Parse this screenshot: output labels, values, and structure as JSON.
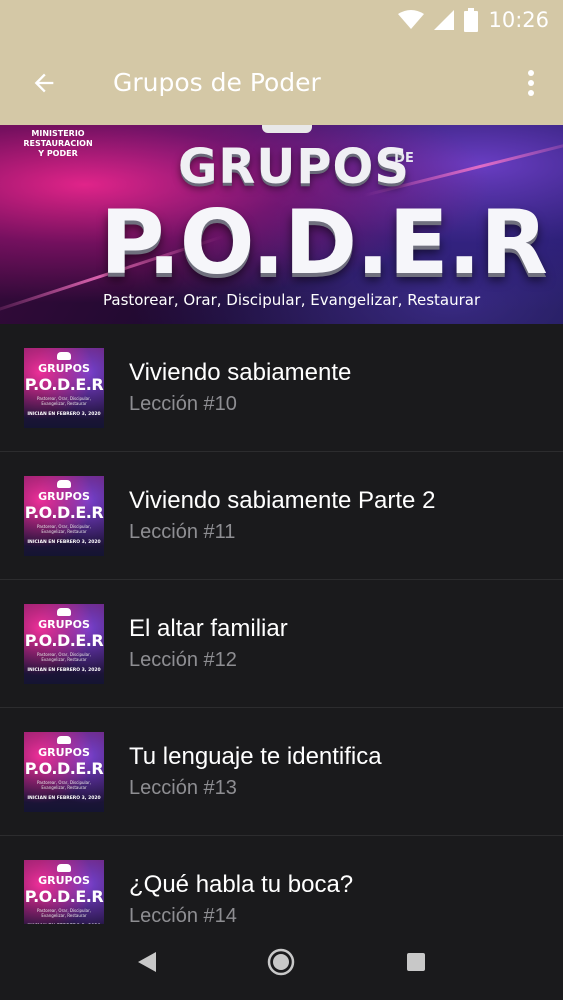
{
  "status_bar": {
    "time": "10:26",
    "icons": [
      "wifi-icon",
      "signal-icon",
      "battery-icon"
    ]
  },
  "app_bar": {
    "title": "Grupos de Poder",
    "back_icon": "arrow-back-icon",
    "menu_icon": "more-vert-icon",
    "background_color": "#d4c8a6"
  },
  "banner": {
    "ministry_line1": "MINISTERIO",
    "ministry_line2": "RESTAURACION",
    "ministry_line3": "Y PODER",
    "heading_top": "GRUPOS",
    "heading_de": "DE",
    "heading_main": "P.O.D.E.R",
    "tagline": "Pastorear, Orar, Discipular, Evangelizar, Restaurar"
  },
  "thumbnail": {
    "grupos": "GRUPOS",
    "poder": "P.O.D.E.R",
    "tagline": "Pastorear, Orar, Discipular, Evangelizar, Restaurar",
    "date": "INICIAN EN FEBRERO 3, 2020"
  },
  "lessons": [
    {
      "title": "Viviendo sabiamente",
      "subtitle": "Lección #10"
    },
    {
      "title": "Viviendo sabiamente Parte 2",
      "subtitle": "Lección #11"
    },
    {
      "title": "El altar familiar",
      "subtitle": "Lección #12"
    },
    {
      "title": "Tu lenguaje te identifica",
      "subtitle": "Lección #13"
    },
    {
      "title": "¿Qué habla tu boca?",
      "subtitle": "Lección #14"
    }
  ],
  "nav_bar": {
    "icons": [
      "nav-back-icon",
      "nav-home-icon",
      "nav-recents-icon"
    ]
  }
}
